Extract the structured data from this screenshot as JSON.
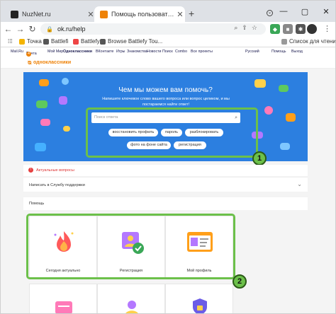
{
  "browser": {
    "tabs": [
      {
        "title": "NuzNet.ru",
        "active": false
      },
      {
        "title": "Помощь пользователям ОК | Гл",
        "active": true
      }
    ],
    "address": "ok.ru/help",
    "bookmarks": [
      "Точка",
      "Battlefi",
      "Battlefy",
      "Browse Battlefy Tou...",
      "Список для чтения"
    ]
  },
  "ok_links": [
    "Mail.Ru",
    "Почта",
    "4",
    "Мой Мир",
    "Одноклассники",
    "ВКонтакте",
    "Игры",
    "Знакомства",
    "Новости",
    "Поиск",
    "Combo",
    "Все проекты",
    "Русский",
    "Помощь",
    "Выход"
  ],
  "brand": {
    "name": "одноклассники",
    "color": "#ee8208"
  },
  "hero": {
    "title": "Чем мы можем вам помочь?",
    "subtitle": "Напишите ключевое слово вашего вопроса или вопрос целиком, и мы постараемся найти ответ!",
    "search_placeholder": "Поиск ответа",
    "chips": [
      "восстановить профиль",
      "пароль",
      "разблокировать",
      "фото на фоне сайта",
      "регистрация"
    ]
  },
  "callouts": [
    "1",
    "2"
  ],
  "alert": {
    "text": "Актуальные вопросы"
  },
  "write_support": {
    "text": "Написать в Службу поддержки"
  },
  "help_section": {
    "title": "Помощь"
  },
  "cards": [
    {
      "label": "Сегодня актуально",
      "icon": "fire-icon"
    },
    {
      "label": "Регистрация",
      "icon": "registration-icon"
    },
    {
      "label": "Мой профиль",
      "icon": "profile-icon"
    }
  ],
  "colors": {
    "hero_bg": "#2c7fe0",
    "highlight": "#6cc04a",
    "accent": "#ee8208"
  }
}
